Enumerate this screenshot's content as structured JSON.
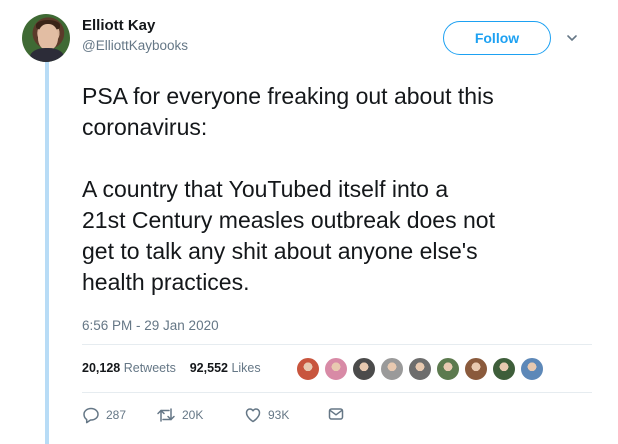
{
  "user": {
    "name": "Elliott Kay",
    "handle": "@ElliottKaybooks"
  },
  "follow_label": "Follow",
  "tweet": {
    "text": "PSA for everyone freaking out about this\ncoronavirus:\n\nA country that YouTubed itself into a\n21st Century measles outbreak does not\nget to talk any shit about anyone else's\nhealth practices.",
    "timestamp": "6:56 PM - 29 Jan 2020"
  },
  "stats": {
    "retweets_count": "20,128",
    "retweets_label": "Retweets",
    "likes_count": "92,552",
    "likes_label": "Likes"
  },
  "likers": [
    {
      "icon": "liker-avatar",
      "color": "#c8553d"
    },
    {
      "icon": "liker-avatar",
      "color": "#d88aa6"
    },
    {
      "icon": "liker-avatar",
      "color": "#4b4b4b"
    },
    {
      "icon": "liker-avatar",
      "color": "#9a9a9a"
    },
    {
      "icon": "liker-avatar",
      "color": "#6d6d6d"
    },
    {
      "icon": "liker-avatar",
      "color": "#5c7a4e"
    },
    {
      "icon": "liker-avatar",
      "color": "#8a5a3c"
    },
    {
      "icon": "liker-avatar",
      "color": "#3e5e3a"
    },
    {
      "icon": "liker-avatar",
      "color": "#5d88b8"
    }
  ],
  "actions": {
    "replies": "287",
    "retweets": "20K",
    "likes": "93K"
  },
  "colors": {
    "accent": "#1da1f2",
    "thread_line": "#b8dcf6",
    "muted_text": "#657786"
  }
}
